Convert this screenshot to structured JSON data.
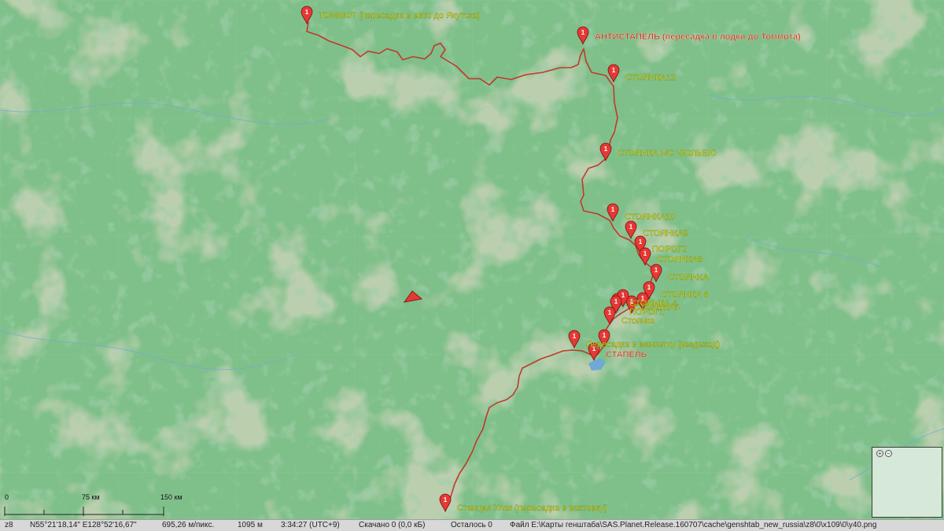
{
  "map": {
    "colors": {
      "base": "#7fc08a",
      "route": "#c0392b",
      "marker": "#e53935",
      "label_yellow": "#f2e600",
      "label_red": "#c0392b"
    },
    "markers": [
      {
        "id": "tommot",
        "label": "ТОММОТ (пересадка в авто до Якутска)",
        "color": "yellow"
      },
      {
        "id": "antistapel",
        "label": "АНТИСТАПЕЛЬ (пересадка в лодки до Томмота)",
        "color": "red"
      },
      {
        "id": "st12",
        "label": "СТОЯНКА12",
        "color": "yellow"
      },
      {
        "id": "stmc",
        "label": "СТОЯНКА МС ЧЮЛЬБЮ",
        "color": "yellow"
      },
      {
        "id": "st10",
        "label": "СТОЯНКА10",
        "color": "yellow"
      },
      {
        "id": "st9",
        "label": "СТОЯНКА9",
        "color": "yellow"
      },
      {
        "id": "porog2",
        "label": "ПОРОГ2",
        "color": "yellow"
      },
      {
        "id": "st8",
        "label": "СТОЯНКА8",
        "color": "yellow"
      },
      {
        "id": "st7",
        "label": "СТОЯНКА",
        "color": "yellow"
      },
      {
        "id": "st6",
        "label": "СТОЯНКА 6",
        "color": "yellow"
      },
      {
        "id": "st5",
        "label": "СТОЯНКА5",
        "color": "yellow"
      },
      {
        "id": "st4",
        "label": "СТОЯНКА 4",
        "color": "yellow"
      },
      {
        "id": "porog1",
        "label": "ПОРОГ1",
        "color": "yellow"
      },
      {
        "id": "st_small",
        "label": "Стоянка",
        "color": "yellow"
      },
      {
        "id": "peresadka",
        "label": "Пересадка в манкетку (вездеход)",
        "color": "yellow"
      },
      {
        "id": "stapel",
        "label": "СТАПЕЛЬ",
        "color": "red"
      },
      {
        "id": "ulak",
        "label": "Станция Улак (пересадка в вахтовку)",
        "color": "yellow"
      }
    ]
  },
  "scale": {
    "labels": [
      "0",
      "75 км",
      "150 км"
    ]
  },
  "status": {
    "zoom": "z8",
    "coords": "N55°21'18,14\" E128°52'16,67\"",
    "resolution": "695,26 м/пикс.",
    "elevation": "1095 м",
    "time": "3:34:27 (UTC+9)",
    "downloaded": "Скачано 0 (0,0 кБ)",
    "remaining": "Осталось 0",
    "file": "Файл E:\\Карты генштаба\\SAS.Planet.Release.160707\\cache\\genshtab_new_russia\\z8\\0\\x109\\0\\y40.png"
  },
  "minimap": {
    "plus": "+",
    "minus": "−"
  }
}
